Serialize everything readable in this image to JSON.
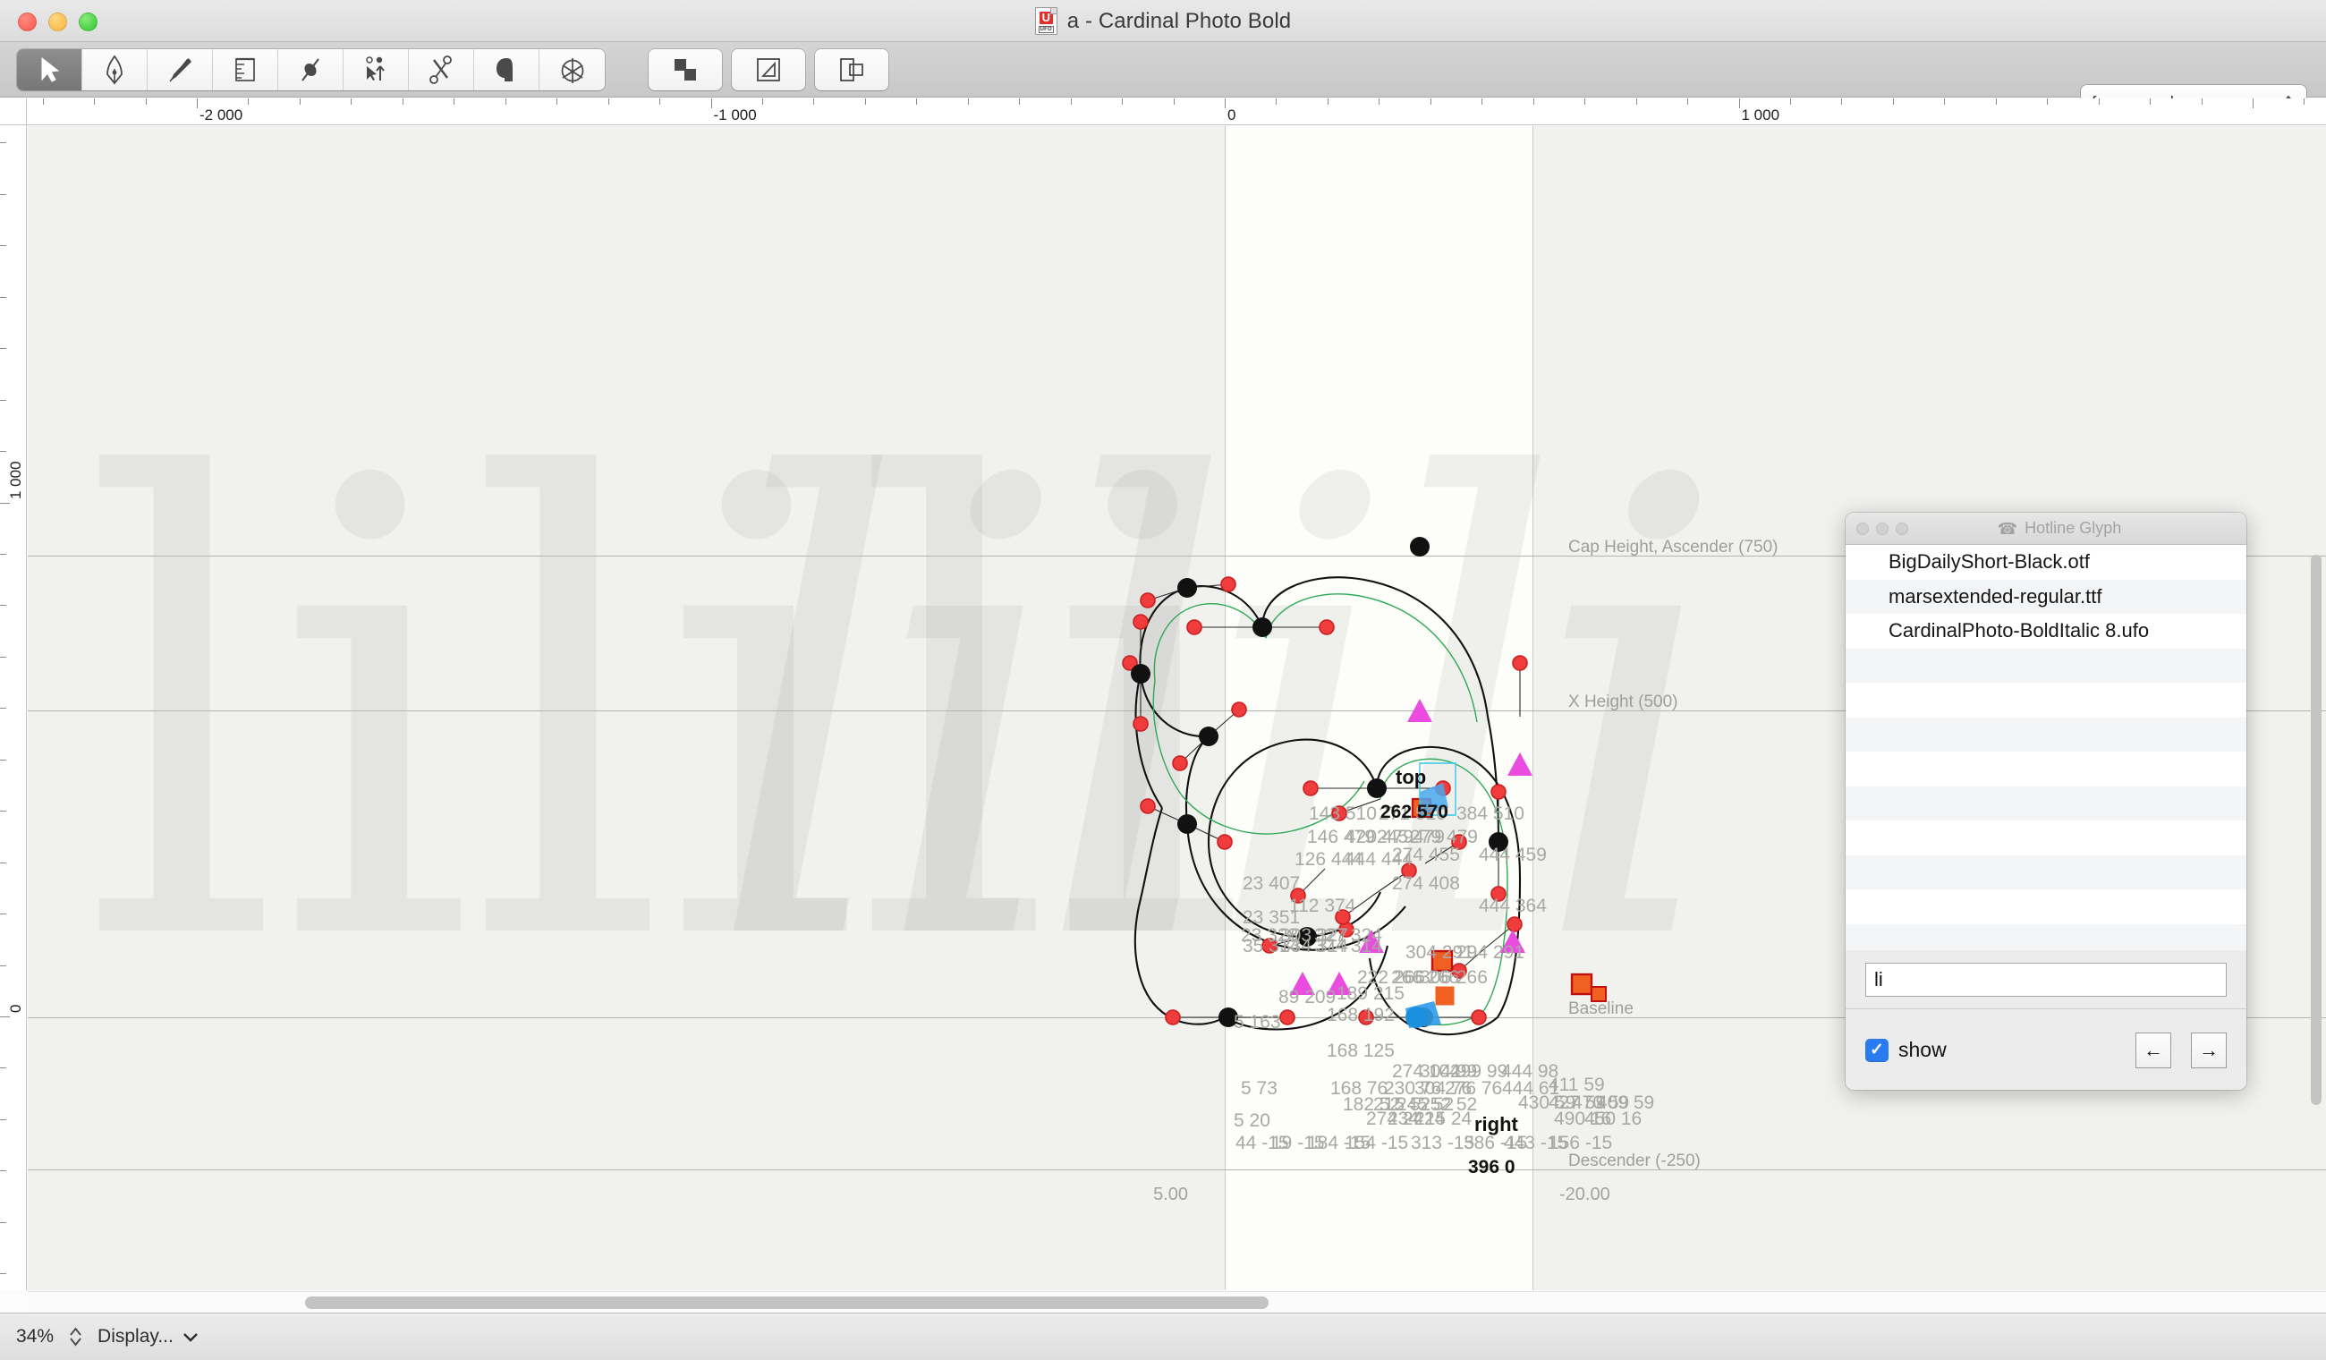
{
  "window": {
    "title": "a - Cardinal Photo Bold",
    "file_icon": "ufo-file-icon",
    "file_icon_letter": "U",
    "file_icon_label": "UFO"
  },
  "toolbar": {
    "tools": [
      {
        "name": "select-tool",
        "icon": "arrow-cursor-icon",
        "active": true
      },
      {
        "name": "pen-tool",
        "icon": "pen-nib-icon",
        "active": false
      },
      {
        "name": "knife-tool",
        "icon": "knife-icon",
        "active": false
      },
      {
        "name": "measure-tool",
        "icon": "ruler-icon",
        "active": false
      },
      {
        "name": "tangent-tool",
        "icon": "tangent-point-icon",
        "active": false
      },
      {
        "name": "shape-edit-tool",
        "icon": "cursor-points-icon",
        "active": false
      },
      {
        "name": "scissors-tool",
        "icon": "scissors-icon",
        "active": false
      },
      {
        "name": "shape-tool",
        "icon": "blob-shape-icon",
        "active": false
      },
      {
        "name": "anchor-tool",
        "icon": "anchor-circle-icon",
        "active": false
      }
    ],
    "extra_buttons": [
      {
        "name": "boolean-ops-button",
        "icon": "overlap-squares-icon"
      },
      {
        "name": "transform-button",
        "icon": "transform-square-icon"
      },
      {
        "name": "compare-layers-button",
        "icon": "two-rects-icon"
      }
    ],
    "layer_select": {
      "value": "foreground",
      "icon": "up-down-chevron-icon"
    }
  },
  "rulers": {
    "horizontal": {
      "labels": [
        "-2 000",
        "-1 000",
        "0",
        "1 000"
      ]
    },
    "vertical": {
      "labels": [
        "1 000",
        "0"
      ]
    }
  },
  "canvas": {
    "metrics": [
      {
        "name": "cap-height-ascender-guide",
        "label": "Cap Height, Ascender (750)",
        "value": 750
      },
      {
        "name": "x-height-guide",
        "label": "X Height (500)",
        "value": 500
      },
      {
        "name": "baseline-guide",
        "label": "Baseline",
        "value": 0
      },
      {
        "name": "descender-guide",
        "label": "Descender (-250)",
        "value": -250
      }
    ],
    "sidebearings": {
      "left": "5.00",
      "right": "-20.00"
    },
    "watermark_text": "lilili",
    "point_names": {
      "top": "top",
      "right": "right"
    },
    "selected_point": "396 0",
    "highlighted_point": "262 570",
    "point_labels": [
      "143 510",
      "271 510",
      "384 510",
      "262 570",
      "146 479",
      "420 479",
      "245 479",
      "279 479",
      "126 444",
      "444 444",
      "274 455",
      "444 459",
      "23 407",
      "274 408",
      "112 374",
      "444 364",
      "23 351",
      "23 328",
      "303 327",
      "327 324",
      "35 314",
      "334 314",
      "374 314",
      "304 291",
      "294 291",
      "222 266",
      "266 266",
      "306 266",
      "89 209",
      "189 215",
      "168 192",
      "5 163",
      "168 125",
      "274 104",
      "304 99",
      "299 99",
      "444 98",
      "5 73",
      "168 76",
      "230 76",
      "304 76",
      "276 76",
      "182 52",
      "215 52",
      "245 52",
      "252 52",
      "444 61",
      "411 59",
      "430 59",
      "427 59",
      "470 59",
      "409 59",
      "5 20",
      "274 24",
      "234 24",
      "215 24",
      "490 16",
      "450 16",
      "44 -15",
      "19 -15",
      "184 -15",
      "154 -15",
      "313 -15",
      "386 -15",
      "443 -15",
      "156 -15",
      "396 0"
    ]
  },
  "panel": {
    "title": "Hotline Glyph",
    "title_icon": "telephone-icon",
    "title_icon_glyph": "☎",
    "traffic_lights": [
      "close-button",
      "minimize-button",
      "zoom-button"
    ],
    "items": [
      "BigDailyShort-Black.otf",
      "marsextended-regular.ttf",
      "CardinalPhoto-BoldItalic 8.ufo"
    ],
    "empty_rows": 9,
    "search": {
      "value": "li",
      "placeholder": ""
    },
    "show_checkbox": {
      "label": "show",
      "checked": true,
      "checkmark": "✓"
    },
    "nav": {
      "prev": "←",
      "next": "→"
    },
    "accent_color": "#2a7bf0"
  },
  "statusbar": {
    "zoom": "34%",
    "zoom_stepper_icon": "up-down-stepper-icon",
    "display_menu": "Display...",
    "display_menu_icon": "chevron-down-icon"
  }
}
